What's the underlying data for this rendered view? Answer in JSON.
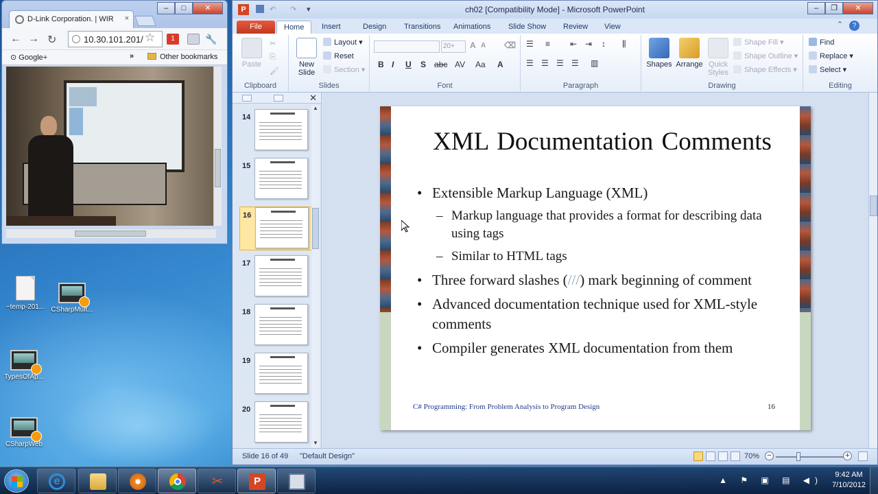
{
  "chrome": {
    "tab_title": "D-Link Corporation. | WIR",
    "tab_close": "×",
    "url": "10.30.101.201/",
    "bookmark_google": "Google+",
    "bookmark_more": "»",
    "other_bookmarks": "Other bookmarks",
    "ext_badge": "1"
  },
  "desktop": {
    "icons": [
      {
        "label": "~temp-201..."
      },
      {
        "label": "CSharpMult..."
      },
      {
        "label": "TypesOfAp..."
      },
      {
        "label": "CSharpWeb"
      }
    ]
  },
  "ppt": {
    "window_title": "ch02 [Compatibility Mode] - Microsoft PowerPoint",
    "tabs": [
      "File",
      "Home",
      "Insert",
      "Design",
      "Transitions",
      "Animations",
      "Slide Show",
      "Review",
      "View"
    ],
    "active_tab": "Home",
    "ribbon": {
      "clipboard": {
        "label": "Clipboard",
        "paste": "Paste"
      },
      "slides": {
        "label": "Slides",
        "new_slide": "New Slide",
        "layout": "Layout",
        "reset": "Reset",
        "section": "Section"
      },
      "font": {
        "label": "Font",
        "size": "20+"
      },
      "paragraph": {
        "label": "Paragraph"
      },
      "drawing": {
        "label": "Drawing",
        "shapes": "Shapes",
        "arrange": "Arrange",
        "quick_styles": "Quick Styles",
        "shape_fill": "Shape Fill",
        "shape_outline": "Shape Outline",
        "shape_effects": "Shape Effects"
      },
      "editing": {
        "label": "Editing",
        "find": "Find",
        "replace": "Replace",
        "select": "Select"
      }
    },
    "thumbnails": [
      {
        "num": "14"
      },
      {
        "num": "15"
      },
      {
        "num": "16",
        "selected": true
      },
      {
        "num": "17"
      },
      {
        "num": "18"
      },
      {
        "num": "19"
      },
      {
        "num": "20"
      }
    ],
    "slide": {
      "title": "XML Documentation Comments",
      "b1": "Extensible Markup Language (XML)",
      "b1_sub1": "Markup language that provides a format for describing data using tags",
      "b1_sub2": "Similar to HTML tags",
      "b2_pre": "Three forward slashes (",
      "b2_slashes": "///",
      "b2_post": ") mark beginning of comment",
      "b3": "Advanced documentation technique used for XML-style comments",
      "b4": "Compiler generates XML documentation from them",
      "footer": "C# Programming: From Problem Analysis to Program Design",
      "number": "16"
    },
    "status": {
      "slide_count": "Slide 16 of 49",
      "theme": "\"Default Design\"",
      "zoom": "70%"
    }
  },
  "taskbar": {
    "time": "9:42 AM",
    "date": "7/10/2012"
  }
}
